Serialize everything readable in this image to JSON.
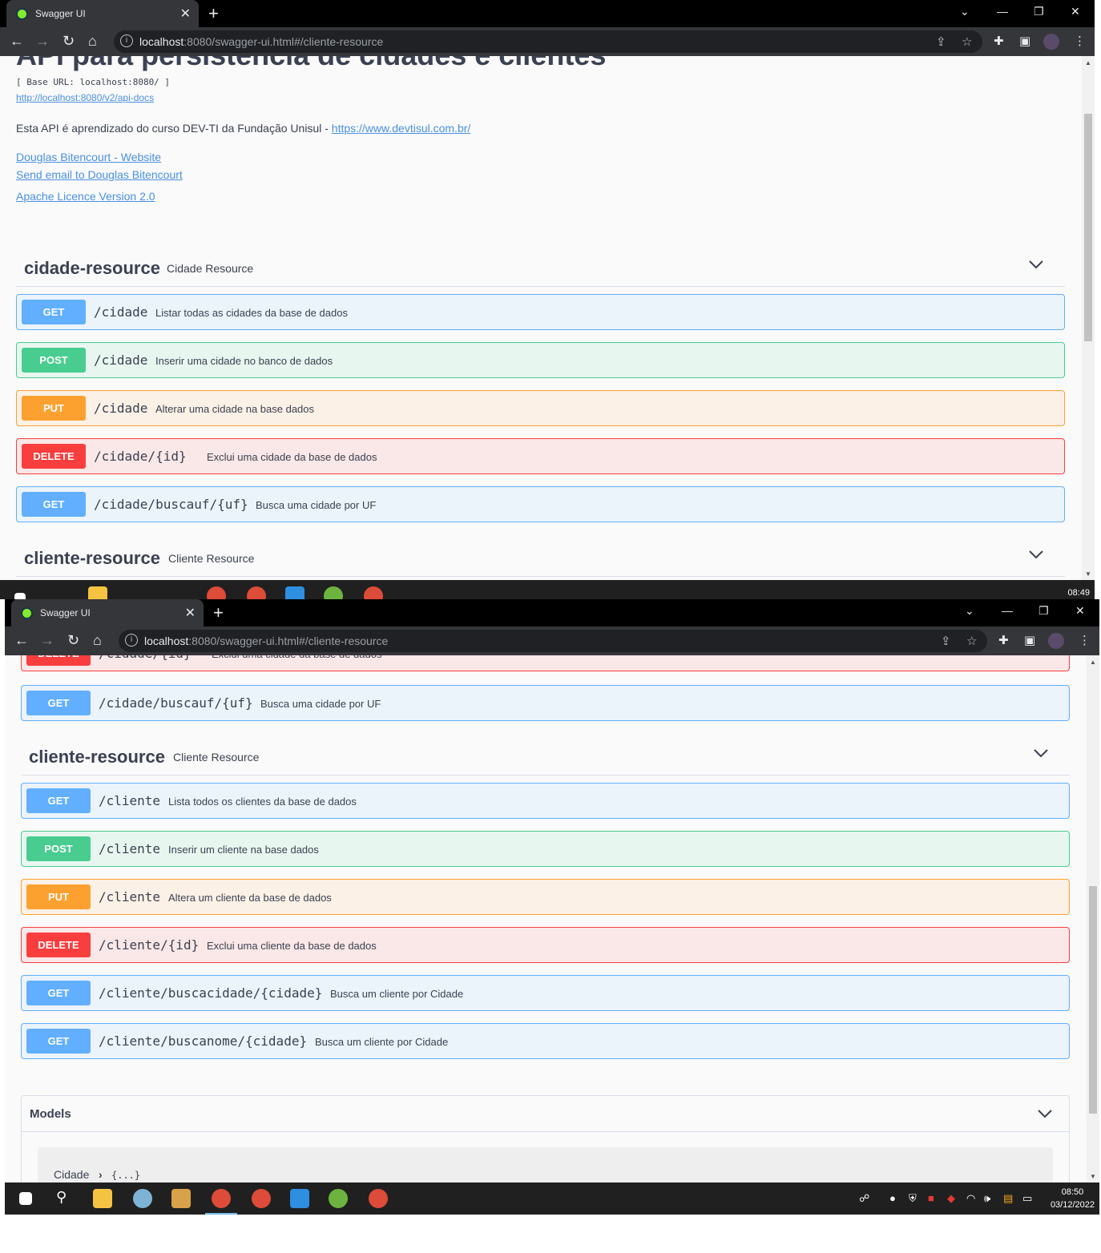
{
  "browser": {
    "tab_title": "Swagger UI",
    "url_host": "localhost",
    "url_rest": ":8080/swagger-ui.html#/cliente-resource"
  },
  "info": {
    "title": "API para persistência de cidades e clientes",
    "base_url": "[ Base URL: localhost:8080/ ]",
    "api_docs_link": "http://localhost:8080/v2/api-docs",
    "description": "Esta API é aprendizado do curso DEV-TI da Fundação Unisul - ",
    "description_link": "https://www.devtisul.com.br/",
    "contact_website": "Douglas Bitencourt - Website",
    "contact_email": "Send email to Douglas Bitencourt",
    "licence": "Apache Licence Version 2.0"
  },
  "tags": {
    "cidade": {
      "name": "cidade-resource",
      "description": "Cidade Resource",
      "operations": [
        {
          "method": "GET",
          "path": "/cidade",
          "summary": "Listar todas as cidades da base de dados"
        },
        {
          "method": "POST",
          "path": "/cidade",
          "summary": "Inserir uma cidade no banco de dados"
        },
        {
          "method": "PUT",
          "path": "/cidade",
          "summary": "Alterar uma cidade na base dados"
        },
        {
          "method": "DELETE",
          "path": "/cidade/{id}",
          "summary": "Exclui uma cidade da base de dados"
        },
        {
          "method": "GET",
          "path": "/cidade/buscauf/{uf}",
          "summary": "Busca uma cidade por UF"
        }
      ]
    },
    "cliente": {
      "name": "cliente-resource",
      "description": "Cliente Resource",
      "operations": [
        {
          "method": "GET",
          "path": "/cliente",
          "summary": "Lista todos os clientes da base de dados"
        },
        {
          "method": "POST",
          "path": "/cliente",
          "summary": "Inserir um cliente na base dados"
        },
        {
          "method": "PUT",
          "path": "/cliente",
          "summary": "Altera um cliente da base de dados"
        },
        {
          "method": "DELETE",
          "path": "/cliente/{id}",
          "summary": "Exclui uma cliente da base de dados"
        },
        {
          "method": "GET",
          "path": "/cliente/buscacidade/{cidade}",
          "summary": "Busca um cliente por Cidade"
        },
        {
          "method": "GET",
          "path": "/cliente/buscanome/{cidade}",
          "summary": "Busca um cliente por Cidade"
        }
      ]
    }
  },
  "models": {
    "title": "Models",
    "first_model": "Cidade",
    "first_model_collapsed": "{...}"
  },
  "taskbar": {
    "time_1": "08:49",
    "time_2": "08:50",
    "date_2": "03/12/2022"
  },
  "colors": {
    "get": "#61affe",
    "post": "#49cc90",
    "put": "#fca130",
    "delete": "#f93e3e",
    "link": "#4990e2",
    "text": "#3b4151"
  }
}
